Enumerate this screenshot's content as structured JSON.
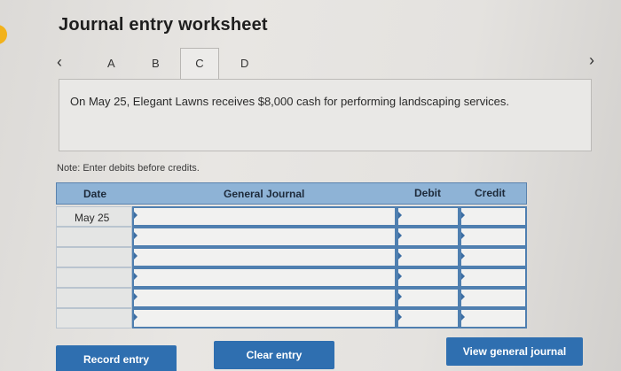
{
  "page": {
    "title": "Journal entry worksheet"
  },
  "tabs": {
    "prev_icon": "‹",
    "next_icon": "›",
    "items": [
      {
        "label": "A"
      },
      {
        "label": "B"
      },
      {
        "label": "C",
        "active": true
      },
      {
        "label": "D"
      }
    ]
  },
  "question": {
    "text": "On May 25, Elegant Lawns receives $8,000 cash for performing landscaping services."
  },
  "note": {
    "text": "Note: Enter debits before credits."
  },
  "journal": {
    "headers": {
      "date": "Date",
      "general_journal": "General Journal",
      "debit": "Debit",
      "credit": "Credit"
    },
    "rows": [
      {
        "date": "May 25",
        "account": "",
        "debit": "",
        "credit": ""
      },
      {
        "date": "",
        "account": "",
        "debit": "",
        "credit": ""
      },
      {
        "date": "",
        "account": "",
        "debit": "",
        "credit": ""
      },
      {
        "date": "",
        "account": "",
        "debit": "",
        "credit": ""
      },
      {
        "date": "",
        "account": "",
        "debit": "",
        "credit": ""
      },
      {
        "date": "",
        "account": "",
        "debit": "",
        "credit": ""
      }
    ]
  },
  "buttons": {
    "record": "Record entry",
    "clear": "Clear entry",
    "view": "View general journal"
  },
  "colors": {
    "header_blue": "#8eb3d6",
    "button_blue": "#2f6fb0",
    "accent_orange": "#f2b21b"
  }
}
